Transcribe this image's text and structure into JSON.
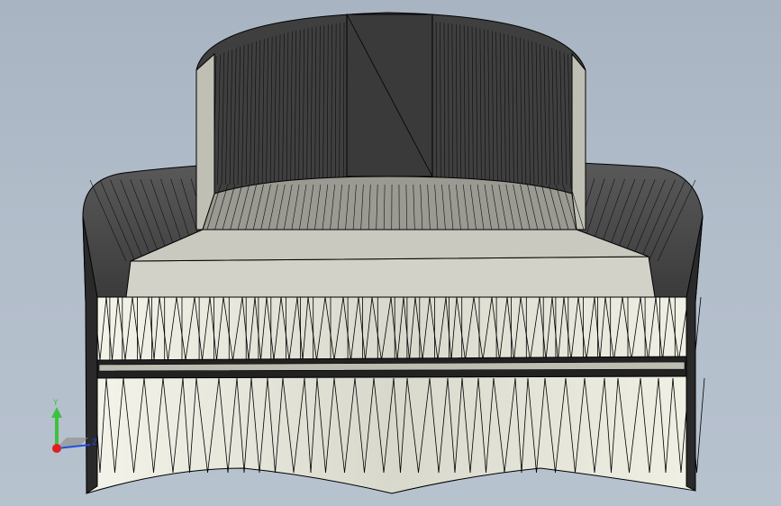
{
  "view": {
    "background_top": "#a8b4c2",
    "background_bottom": "#b7c2cf",
    "wire_color": "#000000",
    "dark_face": "#454545",
    "light_face": "#e6e6da"
  },
  "triad": {
    "y_label": "Y",
    "z_label": "Z",
    "y_color": "#3ec23e",
    "x_color": "#e02020",
    "z_color": "#2050e0"
  }
}
